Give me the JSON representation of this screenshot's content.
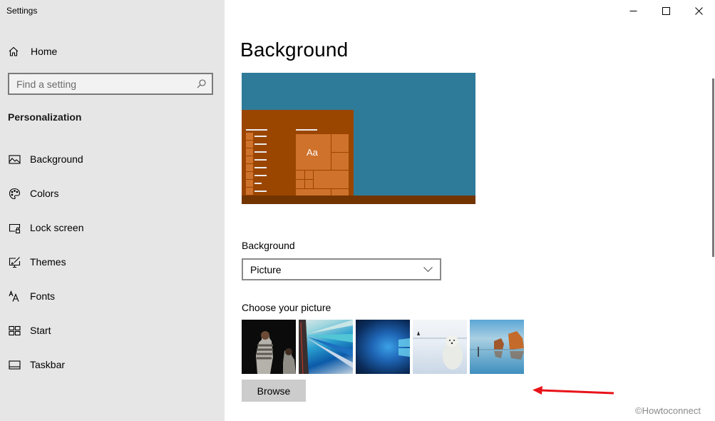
{
  "window": {
    "title": "Settings",
    "controls": {
      "minimize": "minimize-icon",
      "maximize": "maximize-icon",
      "close": "close-icon"
    }
  },
  "sidebar": {
    "home_label": "Home",
    "search_placeholder": "Find a setting",
    "section_title": "Personalization",
    "items": [
      {
        "label": "Background",
        "icon": "picture-icon"
      },
      {
        "label": "Colors",
        "icon": "palette-icon"
      },
      {
        "label": "Lock screen",
        "icon": "lock-screen-icon"
      },
      {
        "label": "Themes",
        "icon": "themes-icon"
      },
      {
        "label": "Fonts",
        "icon": "fonts-icon"
      },
      {
        "label": "Start",
        "icon": "start-icon"
      },
      {
        "label": "Taskbar",
        "icon": "taskbar-icon"
      }
    ]
  },
  "main": {
    "page_title": "Background",
    "preview": {
      "sample_text": "Aa",
      "accent_color": "#9a4500",
      "desktop_color": "#2e7b99"
    },
    "background_label": "Background",
    "background_value": "Picture",
    "choose_label": "Choose your picture",
    "pictures": [
      {
        "name": "two people at night"
      },
      {
        "name": "light streaks tunnel"
      },
      {
        "name": "windows 10 blue"
      },
      {
        "name": "polar bear in snow"
      },
      {
        "name": "rock arches reflection"
      }
    ],
    "browse_label": "Browse"
  },
  "annotation": {
    "arrow_color": "#e8141a"
  },
  "watermark": "©Howtoconnect"
}
